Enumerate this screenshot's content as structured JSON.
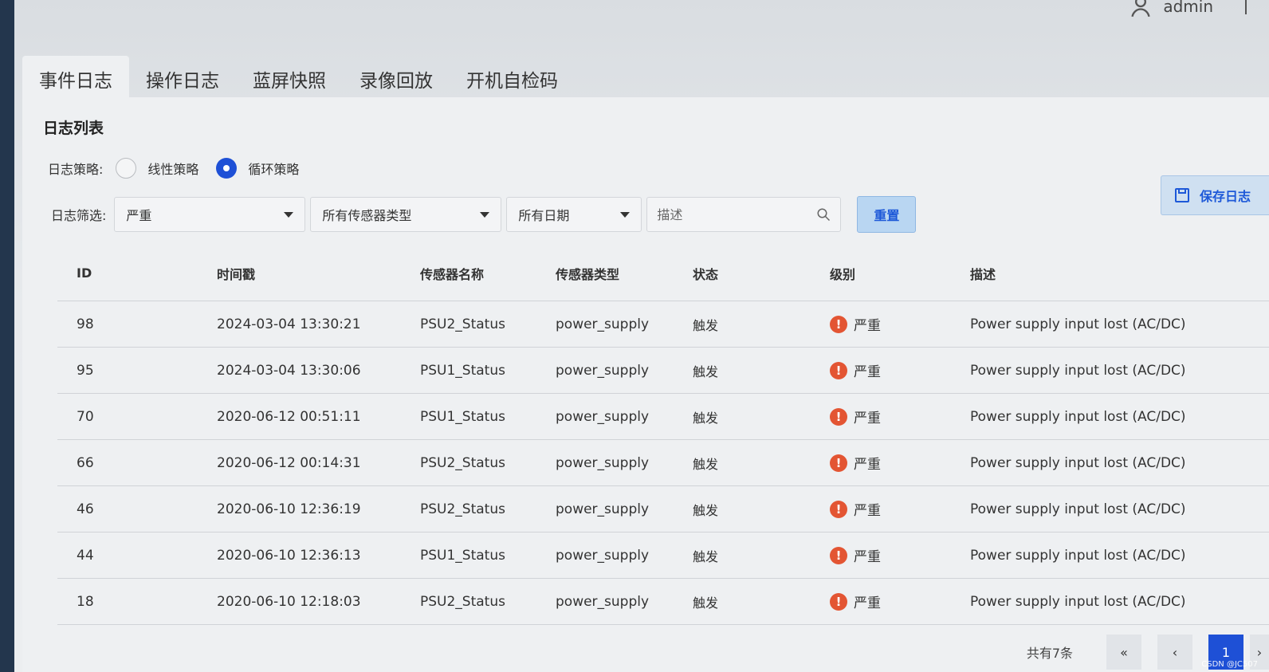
{
  "header": {
    "username": "admin"
  },
  "tabs": [
    {
      "label": "事件日志",
      "active": true
    },
    {
      "label": "操作日志"
    },
    {
      "label": "蓝屏快照"
    },
    {
      "label": "录像回放"
    },
    {
      "label": "开机自检码"
    }
  ],
  "section_title": "日志列表",
  "strategy": {
    "label": "日志策略:",
    "options": [
      {
        "label": "线性策略",
        "checked": false
      },
      {
        "label": "循环策略",
        "checked": true
      }
    ]
  },
  "filters": {
    "label": "日志筛选:",
    "level": "严重",
    "sensor_type": "所有传感器类型",
    "date": "所有日期",
    "desc_placeholder": "描述",
    "reset_label": "重置"
  },
  "save_label": "保存日志",
  "table": {
    "headers": [
      "ID",
      "时间戳",
      "传感器名称",
      "传感器类型",
      "状态",
      "级别",
      "描述"
    ],
    "rows": [
      {
        "id": "98",
        "time": "2024-03-04 13:30:21",
        "name": "PSU2_Status",
        "type": "power_supply",
        "state": "触发",
        "level": "严重",
        "desc": "Power supply input lost (AC/DC)"
      },
      {
        "id": "95",
        "time": "2024-03-04 13:30:06",
        "name": "PSU1_Status",
        "type": "power_supply",
        "state": "触发",
        "level": "严重",
        "desc": "Power supply input lost (AC/DC)"
      },
      {
        "id": "70",
        "time": "2020-06-12 00:51:11",
        "name": "PSU1_Status",
        "type": "power_supply",
        "state": "触发",
        "level": "严重",
        "desc": "Power supply input lost (AC/DC)"
      },
      {
        "id": "66",
        "time": "2020-06-12 00:14:31",
        "name": "PSU2_Status",
        "type": "power_supply",
        "state": "触发",
        "level": "严重",
        "desc": "Power supply input lost (AC/DC)"
      },
      {
        "id": "46",
        "time": "2020-06-10 12:36:19",
        "name": "PSU2_Status",
        "type": "power_supply",
        "state": "触发",
        "level": "严重",
        "desc": "Power supply input lost (AC/DC)"
      },
      {
        "id": "44",
        "time": "2020-06-10 12:36:13",
        "name": "PSU1_Status",
        "type": "power_supply",
        "state": "触发",
        "level": "严重",
        "desc": "Power supply input lost (AC/DC)"
      },
      {
        "id": "18",
        "time": "2020-06-10 12:18:03",
        "name": "PSU2_Status",
        "type": "power_supply",
        "state": "触发",
        "level": "严重",
        "desc": "Power supply input lost (AC/DC)"
      }
    ]
  },
  "pagination": {
    "total_text": "共有7条",
    "first": "«",
    "prev": "‹",
    "current": "1",
    "next": "›"
  },
  "watermark": "CSDN @JC507",
  "colors": {
    "accent": "#1e50d6",
    "severity": "#e35533"
  },
  "icons": {
    "user": "user-icon",
    "search": "search-icon",
    "save": "floppy-disk-icon",
    "level": "exclamation-circle-icon"
  }
}
